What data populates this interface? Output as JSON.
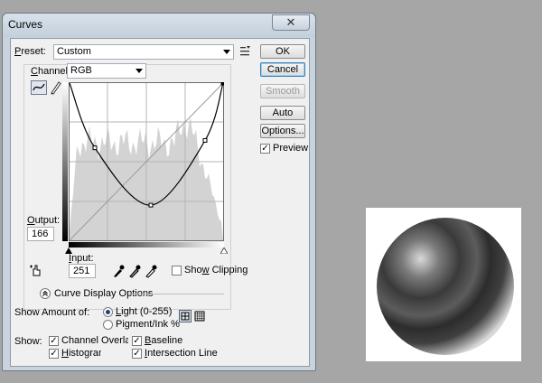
{
  "dialog": {
    "title": "Curves",
    "close_glyph": "✕",
    "preset": {
      "label_u": "P",
      "label_rest": "reset:",
      "value": "Custom"
    },
    "channel": {
      "label_u": "C",
      "label_rest": "hannel:",
      "value": "RGB"
    },
    "output": {
      "label_u": "O",
      "label_rest": "utput:",
      "value": "166"
    },
    "input": {
      "label_u": "I",
      "label_rest": "nput:",
      "value": "251"
    },
    "show_clipping": {
      "pre": "Sho",
      "u": "w",
      "post": " Clipping",
      "checked": false
    },
    "buttons": {
      "ok": "OK",
      "cancel": "Cancel",
      "smooth": "Smooth",
      "auto": "Auto",
      "options": "Options..."
    },
    "preview": {
      "label": "Preview",
      "checked": true
    },
    "curve_display_options": "Curve Display Options",
    "show_amount_of": "Show Amount of:",
    "light": {
      "u": "L",
      "rest": "ight  (0-255)",
      "selected": true
    },
    "pigment": {
      "pre": "Pi",
      "u": "g",
      "rest": "ment/Ink %",
      "selected": false
    },
    "show_label": "Show:",
    "checks": {
      "channel_overlays": {
        "label": "Channel Overlays",
        "checked": true
      },
      "baseline": {
        "u": "B",
        "rest": "aseline",
        "checked": true
      },
      "histogram": {
        "u": "H",
        "rest": "istogram",
        "checked": true
      },
      "intersection_line": {
        "u": "I",
        "rest": "ntersection Line",
        "checked": true
      }
    }
  },
  "curve": {
    "points": [
      [
        0,
        255
      ],
      [
        42,
        150
      ],
      [
        135,
        57
      ],
      [
        225,
        162
      ],
      [
        255,
        255
      ]
    ]
  }
}
